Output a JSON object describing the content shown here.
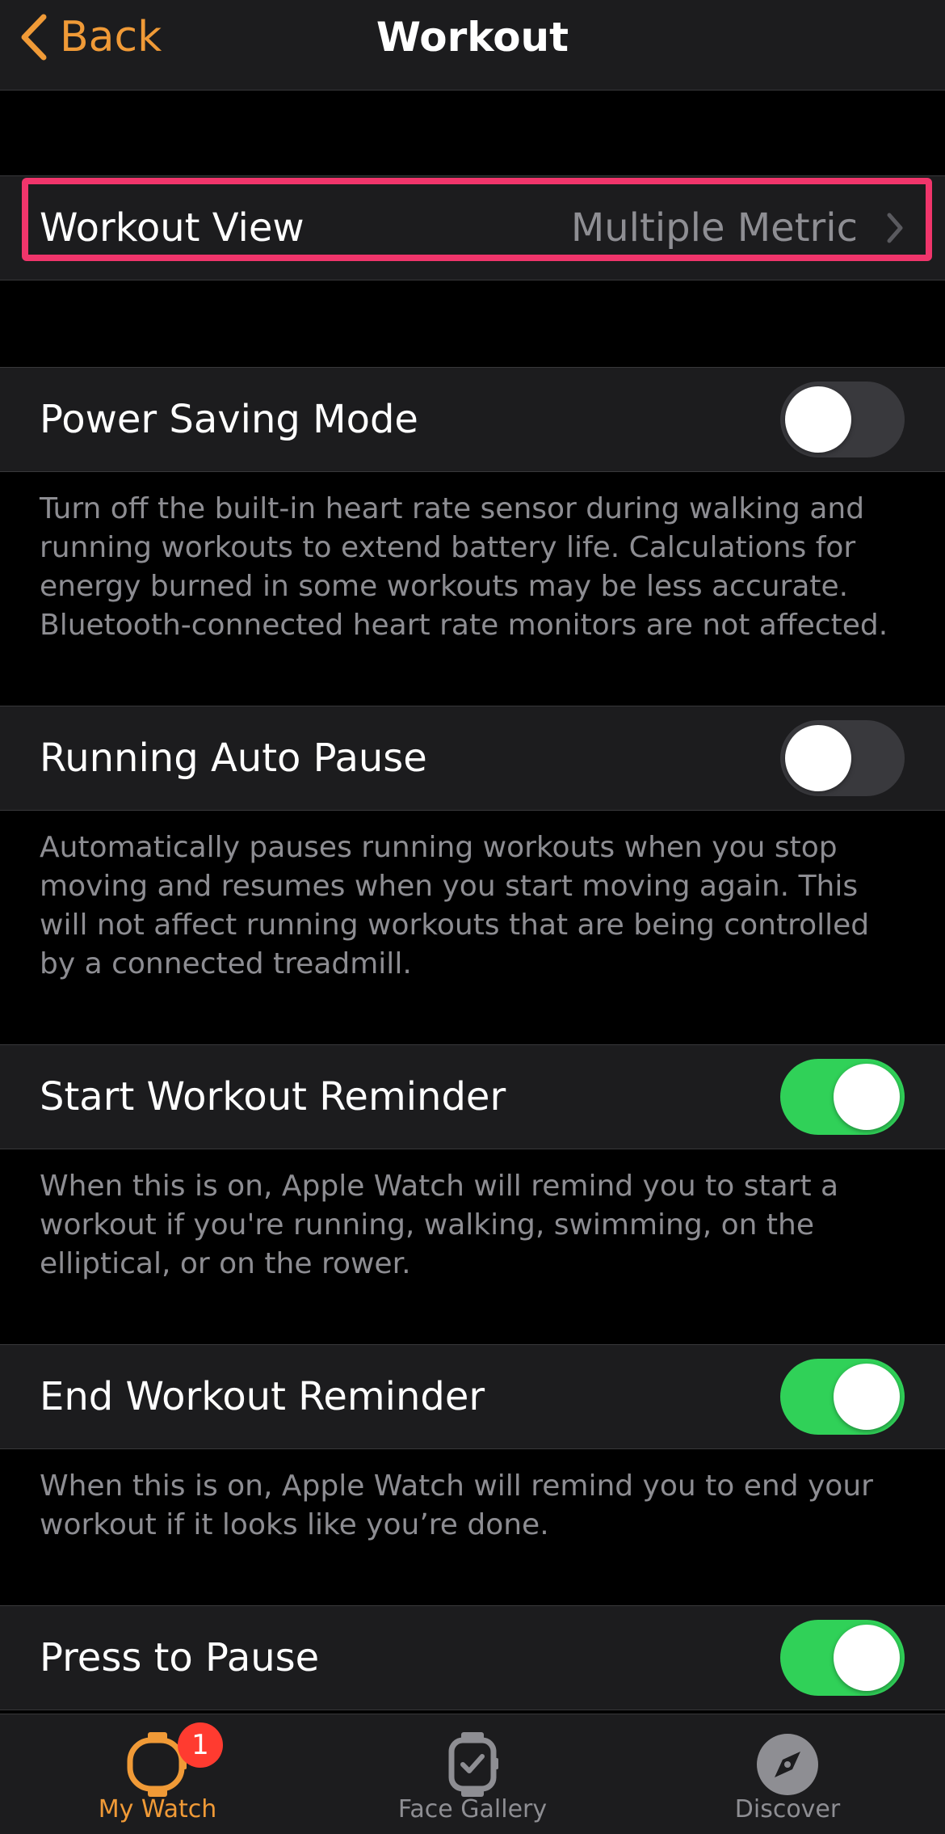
{
  "nav": {
    "back_label": "Back",
    "title": "Workout"
  },
  "workout_view": {
    "label": "Workout View",
    "value": "Multiple Metric"
  },
  "settings": [
    {
      "label": "Power Saving Mode",
      "enabled": false,
      "footer": "Turn off the built-in heart rate sensor during walking and running workouts to extend battery life. Calculations for energy burned in some workouts may be less accurate. Bluetooth-connected heart rate monitors are not affected."
    },
    {
      "label": "Running Auto Pause",
      "enabled": false,
      "footer": "Automatically pauses running workouts when you stop moving and resumes when you start moving again. This will not affect running workouts that are being controlled by a connected treadmill."
    },
    {
      "label": "Start Workout Reminder",
      "enabled": true,
      "footer": "When this is on, Apple Watch will remind you to start a workout if you're running, walking, swimming, on the elliptical, or on the rower."
    },
    {
      "label": "End Workout Reminder",
      "enabled": true,
      "footer": "When this is on, Apple Watch will remind you to end your workout if it looks like you’re done."
    },
    {
      "label": "Press to Pause",
      "enabled": true
    }
  ],
  "tabs": [
    {
      "label": "My Watch",
      "icon": "watch-icon",
      "badge": "1",
      "active": true
    },
    {
      "label": "Face Gallery",
      "icon": "face-gallery-icon",
      "active": false
    },
    {
      "label": "Discover",
      "icon": "compass-icon",
      "active": false
    }
  ],
  "colors": {
    "accent": "#f09a37",
    "toggle_on": "#30d158",
    "highlight": "#f0356b",
    "badge": "#ff3b30"
  }
}
